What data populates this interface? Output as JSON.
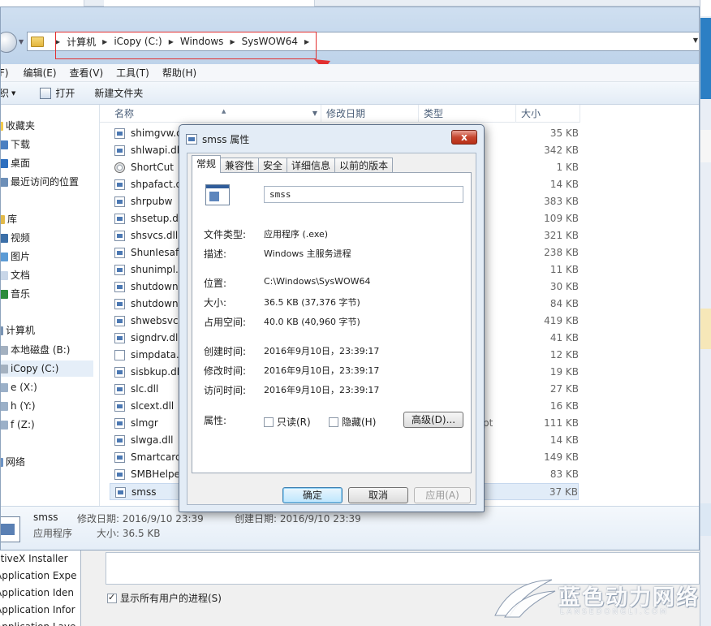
{
  "explorer": {
    "breadcrumb": [
      "计算机",
      "iCopy (C:)",
      "Windows",
      "SysWOW64"
    ],
    "menu": [
      "F)",
      "编辑(E)",
      "查看(V)",
      "工具(T)",
      "帮助(H)"
    ],
    "toolbar": [
      "织",
      "打开",
      "新建文件夹"
    ],
    "nav": [
      {
        "label": "收藏夹"
      },
      {
        "label": "下载"
      },
      {
        "label": "桌面"
      },
      {
        "label": "最近访问的位置"
      },
      {
        "label": "库"
      },
      {
        "label": "视频"
      },
      {
        "label": "图片"
      },
      {
        "label": "文档"
      },
      {
        "label": "音乐"
      },
      {
        "label": "计算机"
      },
      {
        "label": "本地磁盘 (B:)"
      },
      {
        "label": "iCopy (C:)"
      },
      {
        "label": "e (X:)"
      },
      {
        "label": "h (Y:)"
      },
      {
        "label": "f (Z:)"
      },
      {
        "label": "网络"
      }
    ],
    "columns": [
      "名称",
      "修改日期",
      "类型",
      "大小"
    ],
    "files": [
      {
        "name": "shimgvw.d",
        "size": "35 KB"
      },
      {
        "name": "shlwapi.dll",
        "size": "342 KB"
      },
      {
        "name": "ShortCut",
        "size": "1 KB"
      },
      {
        "name": "shpafact.d",
        "size": "14 KB"
      },
      {
        "name": "shrpubw",
        "size": "383 KB"
      },
      {
        "name": "shsetup.dll",
        "size": "109 KB"
      },
      {
        "name": "shsvcs.dll",
        "size": "321 KB"
      },
      {
        "name": "ShunIesafe",
        "size": "238 KB"
      },
      {
        "name": "shunimpl.c",
        "size": "11 KB"
      },
      {
        "name": "shutdown",
        "size": "30 KB"
      },
      {
        "name": "shutdownc",
        "size": "84 KB"
      },
      {
        "name": "shwebsvc.",
        "size": "419 KB"
      },
      {
        "name": "signdrv.dll",
        "size": "41 KB"
      },
      {
        "name": "simpdata.t",
        "size": "12 KB"
      },
      {
        "name": "sisbkup.dll",
        "size": "19 KB"
      },
      {
        "name": "slc.dll",
        "size": "27 KB"
      },
      {
        "name": "slcext.dll",
        "size": "16 KB"
      },
      {
        "name": "slmgr",
        "type": "pt",
        "size": "111 KB"
      },
      {
        "name": "slwga.dll",
        "size": "14 KB"
      },
      {
        "name": "Smartcard",
        "size": "149 KB"
      },
      {
        "name": "SMBHelpe",
        "size": "83 KB"
      },
      {
        "name": "smss",
        "size": "37 KB"
      }
    ],
    "status": {
      "name": "smss",
      "modified_label": "修改日期: 2016/9/10 23:39",
      "created_label": "创建日期: 2016/9/10 23:39",
      "type": "应用程序",
      "size_label": "大小: 36.5 KB"
    }
  },
  "bg": {
    "list": [
      "ctiveX Installer",
      "Application Expe",
      "Application Iden",
      "Application Infor",
      "Application Laye"
    ],
    "show_all": "显示所有用户的进程(S)"
  },
  "dialog": {
    "title": "smss 属性",
    "close": "x",
    "tabs": [
      "常规",
      "兼容性",
      "安全",
      "详细信息",
      "以前的版本"
    ],
    "name": "smss",
    "rows": [
      {
        "label": "文件类型:",
        "value": "应用程序 (.exe)"
      },
      {
        "label": "描述:",
        "value": "Windows 主服务进程"
      },
      {
        "label": "位置:",
        "value": "C:\\Windows\\SysWOW64"
      },
      {
        "label": "大小:",
        "value": "36.5 KB (37,376 字节)"
      },
      {
        "label": "占用空间:",
        "value": "40.0 KB (40,960 字节)"
      },
      {
        "label": "创建时间:",
        "value": "2016年9月10日，23:39:17"
      },
      {
        "label": "修改时间:",
        "value": "2016年9月10日，23:39:17"
      },
      {
        "label": "访问时间:",
        "value": "2016年9月10日，23:39:17"
      }
    ],
    "attributes_label": "属性:",
    "readonly": "只读(R)",
    "hidden": "隐藏(H)",
    "advanced": "高级(D)...",
    "ok": "确定",
    "cancel": "取消",
    "apply": "应用(A)"
  },
  "watermark": {
    "text": "蓝色动力网络",
    "sub": "LANSEDONGLI.COM"
  },
  "colors": {
    "annotation": "#e23030",
    "selection": "#e1ecf8",
    "close_button": "#c7462f"
  }
}
